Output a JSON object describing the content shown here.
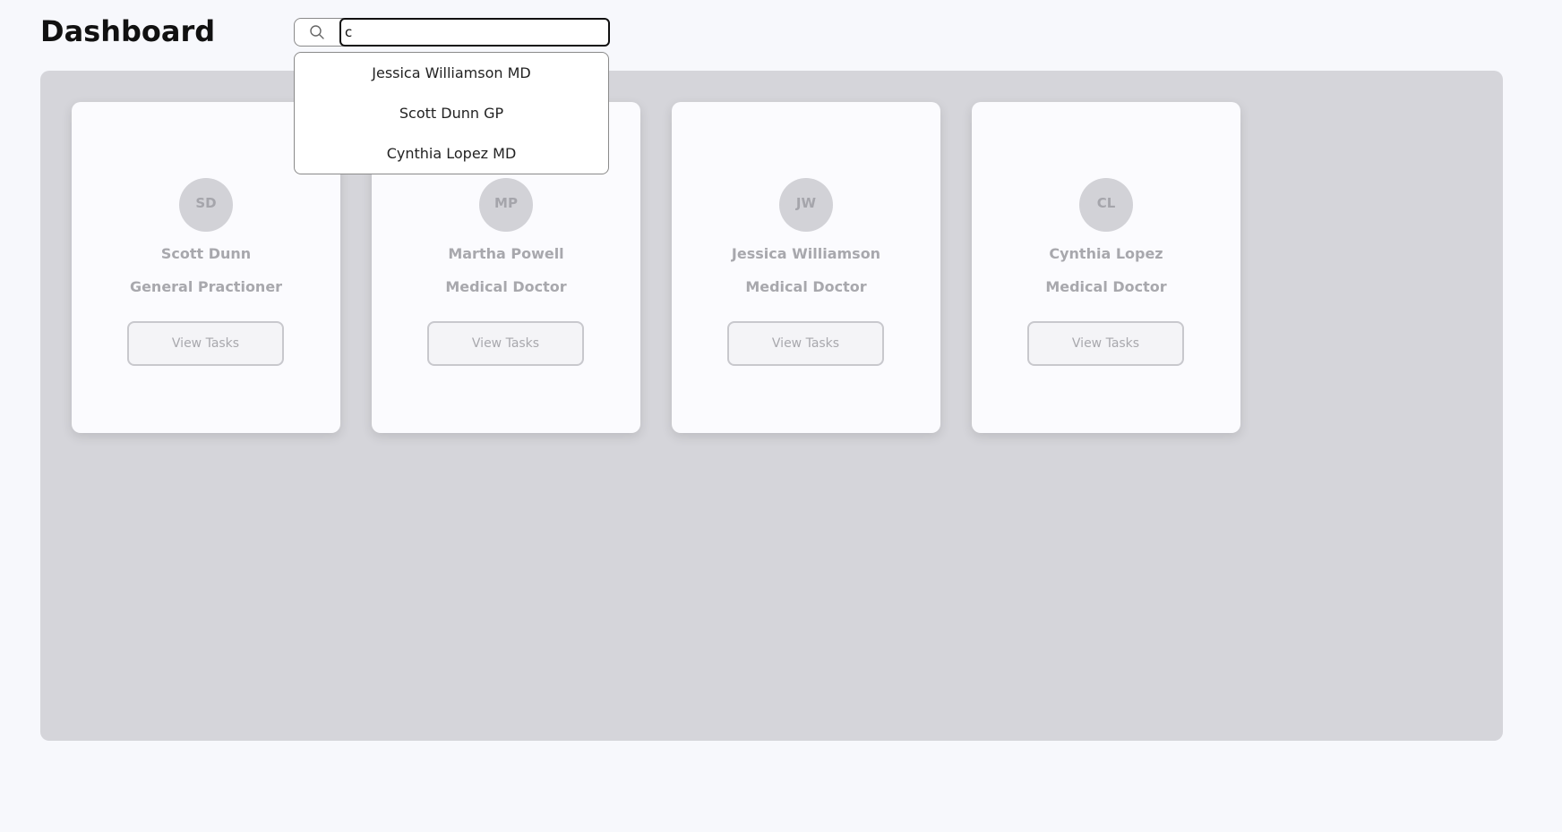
{
  "header": {
    "title": "Dashboard"
  },
  "search": {
    "value": "c",
    "icon": "search-icon",
    "suggestions": [
      "Jessica Williamson MD",
      "Scott Dunn GP",
      "Cynthia Lopez MD"
    ]
  },
  "cards": [
    {
      "initials": "SD",
      "name": "Scott Dunn",
      "role": "General Practioner",
      "button": "View Tasks"
    },
    {
      "initials": "MP",
      "name": "Martha Powell",
      "role": "Medical Doctor",
      "button": "View Tasks"
    },
    {
      "initials": "JW",
      "name": "Jessica Williamson",
      "role": "Medical Doctor",
      "button": "View Tasks"
    },
    {
      "initials": "CL",
      "name": "Cynthia Lopez",
      "role": "Medical Doctor",
      "button": "View Tasks"
    }
  ],
  "colors": {
    "background": "#f7f8fc",
    "panel": "#d5d5da",
    "card": "#fbfbfe",
    "muted_text": "#a8a8ad"
  }
}
